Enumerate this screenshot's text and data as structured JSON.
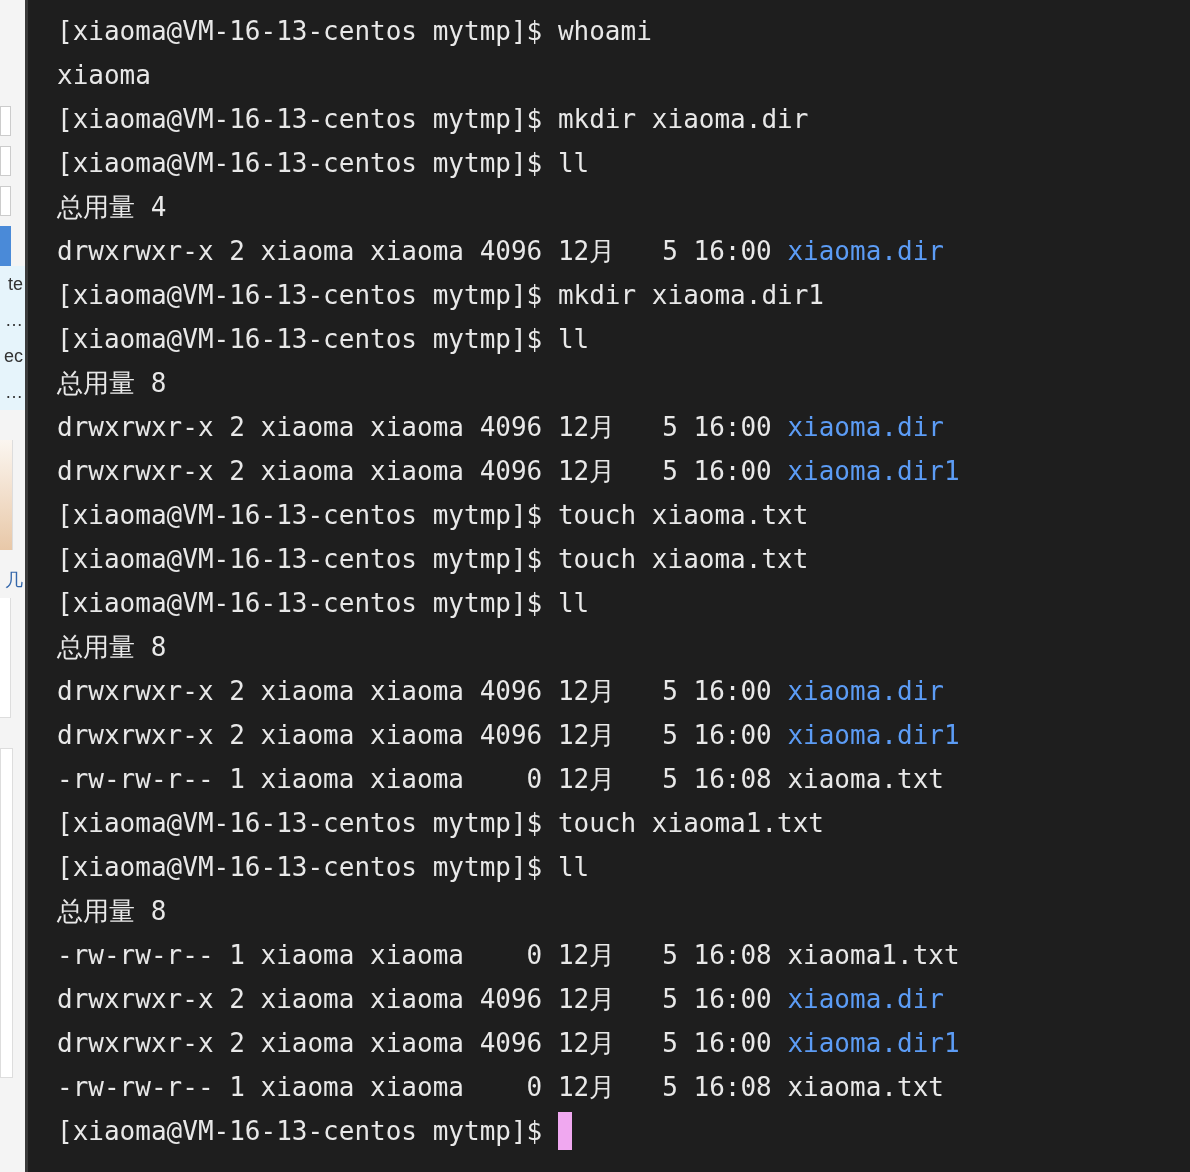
{
  "side_window": {
    "fragments": [
      "te",
      "…",
      "ec",
      "…",
      "几"
    ]
  },
  "terminal": {
    "lines": [
      {
        "kind": "prompt",
        "prompt": "[xiaoma@VM-16-13-centos mytmp]$ ",
        "command": "whoami"
      },
      {
        "kind": "output",
        "text": "xiaoma"
      },
      {
        "kind": "prompt",
        "prompt": "[xiaoma@VM-16-13-centos mytmp]$ ",
        "command": "mkdir xiaoma.dir"
      },
      {
        "kind": "prompt",
        "prompt": "[xiaoma@VM-16-13-centos mytmp]$ ",
        "command": "ll"
      },
      {
        "kind": "output",
        "text": "总用量 4"
      },
      {
        "kind": "entry",
        "info": "drwxrwxr-x 2 xiaoma xiaoma 4096 12月   5 16:00 ",
        "name": "xiaoma.dir",
        "directory": true
      },
      {
        "kind": "prompt",
        "prompt": "[xiaoma@VM-16-13-centos mytmp]$ ",
        "command": "mkdir xiaoma.dir1"
      },
      {
        "kind": "prompt",
        "prompt": "[xiaoma@VM-16-13-centos mytmp]$ ",
        "command": "ll"
      },
      {
        "kind": "output",
        "text": "总用量 8"
      },
      {
        "kind": "entry",
        "info": "drwxrwxr-x 2 xiaoma xiaoma 4096 12月   5 16:00 ",
        "name": "xiaoma.dir",
        "directory": true
      },
      {
        "kind": "entry",
        "info": "drwxrwxr-x 2 xiaoma xiaoma 4096 12月   5 16:00 ",
        "name": "xiaoma.dir1",
        "directory": true
      },
      {
        "kind": "prompt",
        "prompt": "[xiaoma@VM-16-13-centos mytmp]$ ",
        "command": "touch xiaoma.txt"
      },
      {
        "kind": "prompt",
        "prompt": "[xiaoma@VM-16-13-centos mytmp]$ ",
        "command": "touch xiaoma.txt"
      },
      {
        "kind": "prompt",
        "prompt": "[xiaoma@VM-16-13-centos mytmp]$ ",
        "command": "ll"
      },
      {
        "kind": "output",
        "text": "总用量 8"
      },
      {
        "kind": "entry",
        "info": "drwxrwxr-x 2 xiaoma xiaoma 4096 12月   5 16:00 ",
        "name": "xiaoma.dir",
        "directory": true
      },
      {
        "kind": "entry",
        "info": "drwxrwxr-x 2 xiaoma xiaoma 4096 12月   5 16:00 ",
        "name": "xiaoma.dir1",
        "directory": true
      },
      {
        "kind": "entry",
        "info": "-rw-rw-r-- 1 xiaoma xiaoma    0 12月   5 16:08 ",
        "name": "xiaoma.txt",
        "directory": false
      },
      {
        "kind": "prompt",
        "prompt": "[xiaoma@VM-16-13-centos mytmp]$ ",
        "command": "touch xiaoma1.txt"
      },
      {
        "kind": "prompt",
        "prompt": "[xiaoma@VM-16-13-centos mytmp]$ ",
        "command": "ll"
      },
      {
        "kind": "output",
        "text": "总用量 8"
      },
      {
        "kind": "entry",
        "info": "-rw-rw-r-- 1 xiaoma xiaoma    0 12月   5 16:08 ",
        "name": "xiaoma1.txt",
        "directory": false
      },
      {
        "kind": "entry",
        "info": "drwxrwxr-x 2 xiaoma xiaoma 4096 12月   5 16:00 ",
        "name": "xiaoma.dir",
        "directory": true
      },
      {
        "kind": "entry",
        "info": "drwxrwxr-x 2 xiaoma xiaoma 4096 12月   5 16:00 ",
        "name": "xiaoma.dir1",
        "directory": true
      },
      {
        "kind": "entry",
        "info": "-rw-rw-r-- 1 xiaoma xiaoma    0 12月   5 16:08 ",
        "name": "xiaoma.txt",
        "directory": false
      },
      {
        "kind": "prompt",
        "prompt": "[xiaoma@VM-16-13-centos mytmp]$ ",
        "cursor": true
      }
    ]
  }
}
